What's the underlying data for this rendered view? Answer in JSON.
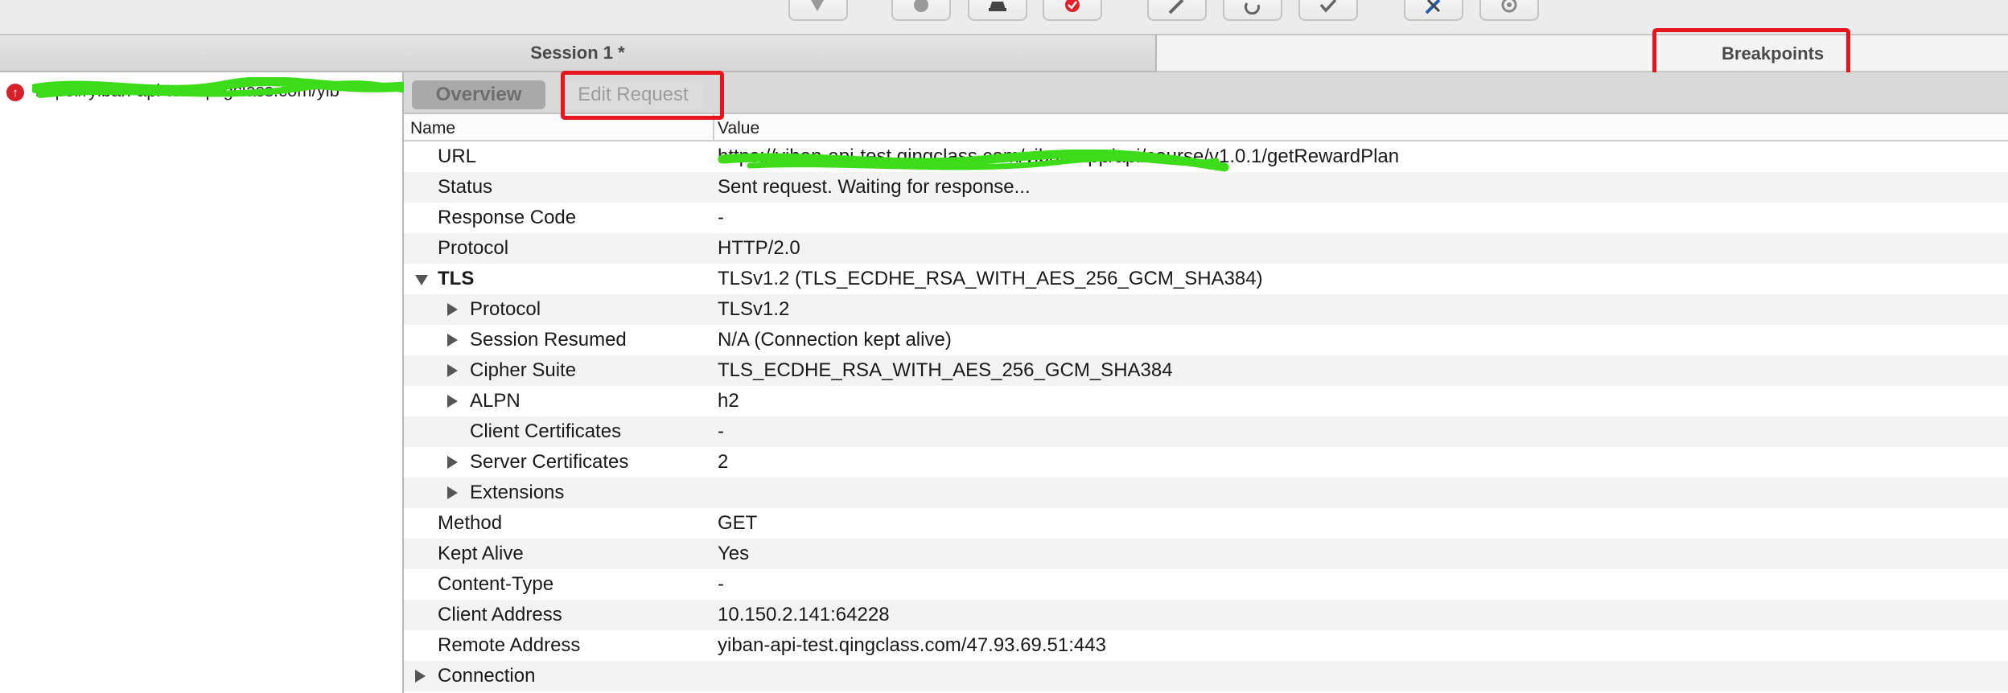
{
  "toolbar": {
    "buttons": [
      {
        "icon": "pen-icon"
      },
      {
        "icon": "record-icon"
      },
      {
        "icon": "throttle-icon"
      },
      {
        "icon": "breakpoint-icon"
      },
      {
        "icon": "edit-icon"
      },
      {
        "icon": "repeat-icon"
      },
      {
        "icon": "validate-icon"
      },
      {
        "icon": "tools-icon"
      },
      {
        "icon": "settings-icon"
      }
    ]
  },
  "session": {
    "title": "Session 1 *",
    "breakpoints_label": "Breakpoints"
  },
  "sidebar": {
    "item_url": "https://yiban-api-test.qingclass.com/yib"
  },
  "detail": {
    "tabs": {
      "overview": "Overview",
      "edit_request": "Edit Request"
    },
    "columns": {
      "name": "Name",
      "value": "Value"
    },
    "rows": [
      {
        "name": "URL",
        "value": "https://yiban-api-test.qingclass.com/yiban-app/api/course/v1.0.1/getRewardPlan",
        "level": 0,
        "toggle": "none",
        "bold": false
      },
      {
        "name": "Status",
        "value": "Sent request. Waiting for response...",
        "level": 0,
        "toggle": "none",
        "bold": false
      },
      {
        "name": "Response Code",
        "value": "-",
        "level": 0,
        "toggle": "none",
        "bold": false
      },
      {
        "name": "Protocol",
        "value": "HTTP/2.0",
        "level": 0,
        "toggle": "none",
        "bold": false
      },
      {
        "name": "TLS",
        "value": "TLSv1.2 (TLS_ECDHE_RSA_WITH_AES_256_GCM_SHA384)",
        "level": 0,
        "toggle": "open",
        "bold": true
      },
      {
        "name": "Protocol",
        "value": "TLSv1.2",
        "level": 1,
        "toggle": "closed",
        "bold": false
      },
      {
        "name": "Session Resumed",
        "value": "N/A (Connection kept alive)",
        "level": 1,
        "toggle": "closed",
        "bold": false
      },
      {
        "name": "Cipher Suite",
        "value": "TLS_ECDHE_RSA_WITH_AES_256_GCM_SHA384",
        "level": 1,
        "toggle": "closed",
        "bold": false
      },
      {
        "name": "ALPN",
        "value": "h2",
        "level": 1,
        "toggle": "closed",
        "bold": false
      },
      {
        "name": "Client Certificates",
        "value": "-",
        "level": 1,
        "toggle": "none",
        "bold": false
      },
      {
        "name": "Server Certificates",
        "value": "2",
        "level": 1,
        "toggle": "closed",
        "bold": false
      },
      {
        "name": "Extensions",
        "value": "",
        "level": 1,
        "toggle": "closed",
        "bold": false
      },
      {
        "name": "Method",
        "value": "GET",
        "level": 0,
        "toggle": "none",
        "bold": false
      },
      {
        "name": "Kept Alive",
        "value": "Yes",
        "level": 0,
        "toggle": "none",
        "bold": false
      },
      {
        "name": "Content-Type",
        "value": "-",
        "level": 0,
        "toggle": "none",
        "bold": false
      },
      {
        "name": "Client Address",
        "value": "10.150.2.141:64228",
        "level": 0,
        "toggle": "none",
        "bold": false
      },
      {
        "name": "Remote Address",
        "value": "yiban-api-test.qingclass.com/47.93.69.51:443",
        "level": 0,
        "toggle": "none",
        "bold": false
      },
      {
        "name": "Connection",
        "value": "",
        "level": 0,
        "toggle": "closed",
        "bold": false
      }
    ]
  },
  "colors": {
    "highlight_box": "#e8141b",
    "redaction_scribble": "#3ddc1a",
    "active_tab": "#a9a9a9"
  }
}
